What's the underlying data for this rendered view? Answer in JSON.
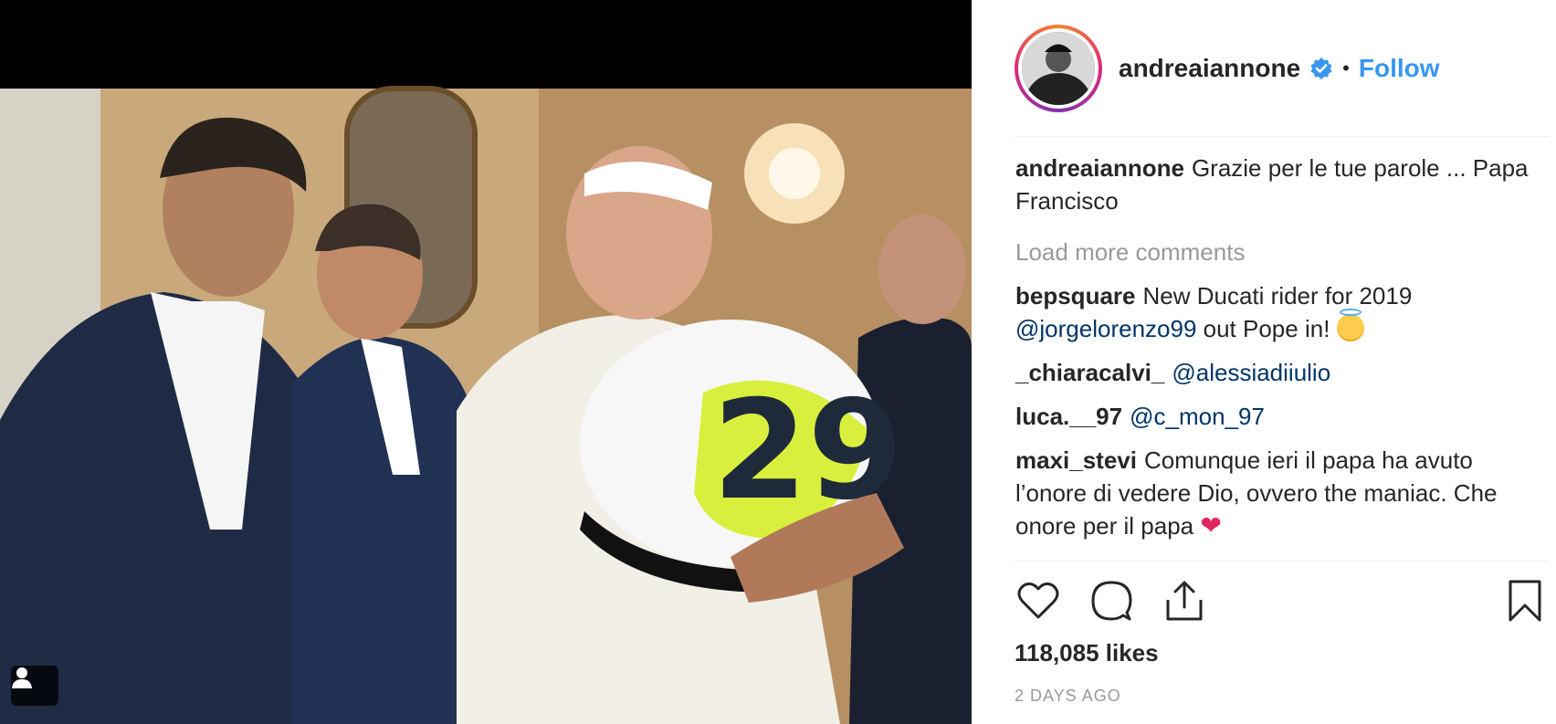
{
  "post": {
    "author": "andreaiannone",
    "follow_label": "Follow",
    "separator": "•",
    "caption": {
      "username": "andreaiannone",
      "text": "Grazie per le tue parole ... Papa Francisco"
    },
    "load_more": "Load more comments",
    "comments": [
      {
        "username": "bepsquare",
        "text_before": "New Ducati rider for 2019",
        "mention": "@jorgelorenzo99",
        "text_after": "out Pope in!",
        "emoji": "smiling-face-with-halo"
      },
      {
        "username": "_chiaracalvi_",
        "mention": "@alessiadiiulio"
      },
      {
        "username": "luca.__97",
        "mention": "@c_mon_97"
      },
      {
        "username": "maxi_stevi",
        "text": "Comunque ieri il papa ha avuto l’onore di vedere Dio, ovvero the maniac. Che onore per il papa",
        "emoji": "❤"
      }
    ],
    "likes": "118,085 likes",
    "date": "2 DAYS AGO"
  },
  "icons": [
    "verified-badge-icon",
    "heart-icon",
    "comment-icon",
    "share-icon",
    "bookmark-icon",
    "user-tag-icon"
  ],
  "colors": {
    "link": "#3897f0",
    "mention": "#003569",
    "muted": "#999999",
    "verified": "#3897f0",
    "heart": "#e0245e"
  }
}
